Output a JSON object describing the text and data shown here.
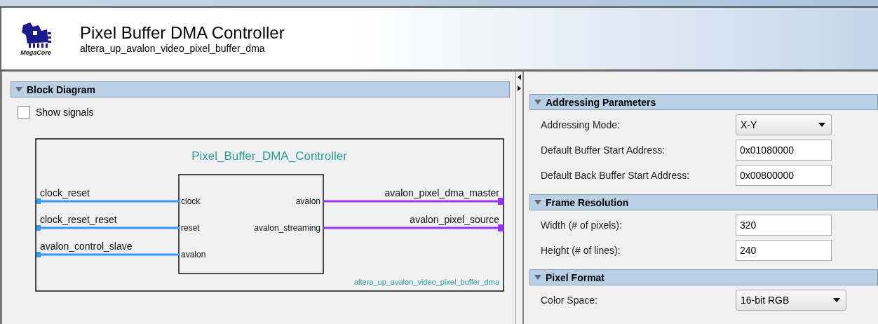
{
  "header": {
    "title": "Pixel Buffer DMA Controller",
    "subtitle": "altera_up_avalon_video_pixel_buffer_dma",
    "logo_text": "MegaCore"
  },
  "block_diagram": {
    "title": "Block Diagram",
    "expanded": true,
    "show_signals": {
      "label": "Show signals",
      "checked": false
    },
    "diagram": {
      "title": "Pixel_Buffer_DMA_Controller",
      "instance": "altera_up_avalon_video_pixel_buffer_dma",
      "inputs": [
        {
          "signal": "clock_reset",
          "port": "clock",
          "color": "#3399ff"
        },
        {
          "signal": "clock_reset_reset",
          "port": "reset",
          "color": "#3399ff"
        },
        {
          "signal": "avalon_control_slave",
          "port": "avalon",
          "color": "#3399ff"
        }
      ],
      "outputs": [
        {
          "signal": "avalon_pixel_dma_master",
          "port": "avalon",
          "color": "#9933ff"
        },
        {
          "signal": "avalon_pixel_source",
          "port": "avalon_streaming",
          "color": "#9933ff"
        }
      ]
    }
  },
  "sections": [
    {
      "title": "Addressing Parameters",
      "expanded": true,
      "fields": [
        {
          "kind": "dropdown",
          "label": "Addressing Mode:",
          "value": "X-Y"
        },
        {
          "kind": "text",
          "label": "Default Buffer Start Address:",
          "value": "0x01080000"
        },
        {
          "kind": "text",
          "label": "Default Back Buffer Start Address:",
          "value": "0x00800000"
        }
      ]
    },
    {
      "title": "Frame Resolution",
      "expanded": true,
      "fields": [
        {
          "kind": "text",
          "label": "Width (# of pixels):",
          "value": "320"
        },
        {
          "kind": "text",
          "label": "Height (# of lines):",
          "value": "240"
        }
      ]
    },
    {
      "title": "Pixel Format",
      "expanded": true,
      "fields": [
        {
          "kind": "dropdown",
          "label": "Color Space:",
          "value": "16-bit RGB",
          "wide": true
        }
      ]
    }
  ]
}
